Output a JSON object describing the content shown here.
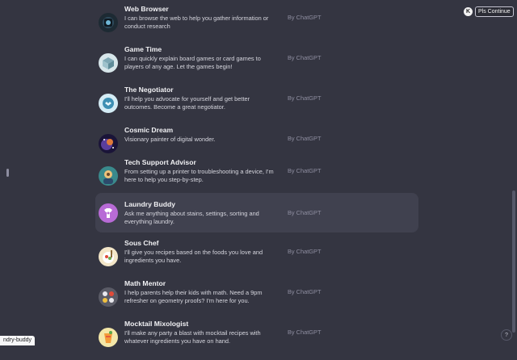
{
  "top_action": {
    "icon": "k-extension-icon",
    "icon_letter": "K",
    "label": "Pls Continue"
  },
  "gpts": [
    {
      "name": "Web Browser",
      "desc": "I can browse the web to help you gather information or conduct research",
      "by": "By ChatGPT",
      "icon": "web-browser-icon"
    },
    {
      "name": "Game Time",
      "desc": "I can quickly explain board games or card games to players of any age. Let the games begin!",
      "by": "By ChatGPT",
      "icon": "game-time-icon"
    },
    {
      "name": "The Negotiator",
      "desc": "I'll help you advocate for yourself and get better outcomes. Become a great negotiator.",
      "by": "By ChatGPT",
      "icon": "negotiator-icon"
    },
    {
      "name": "Cosmic Dream",
      "desc": "Visionary painter of digital wonder.",
      "by": "By ChatGPT",
      "icon": "cosmic-dream-icon"
    },
    {
      "name": "Tech Support Advisor",
      "desc": "From setting up a printer to troubleshooting a device, I'm here to help you step-by-step.",
      "by": "By ChatGPT",
      "icon": "tech-support-icon"
    },
    {
      "name": "Laundry Buddy",
      "desc": "Ask me anything about stains, settings, sorting and everything laundry.",
      "by": "By ChatGPT",
      "icon": "laundry-buddy-icon"
    },
    {
      "name": "Sous Chef",
      "desc": "I'll give you recipes based on the foods you love and ingredients you have.",
      "by": "By ChatGPT",
      "icon": "sous-chef-icon"
    },
    {
      "name": "Math Mentor",
      "desc": "I help parents help their kids with math. Need a 9pm refresher on geometry proofs? I'm here for you.",
      "by": "By ChatGPT",
      "icon": "math-mentor-icon"
    },
    {
      "name": "Mocktail Mixologist",
      "desc": "I'll make any party a blast with mocktail recipes with whatever ingredients you have on hand.",
      "by": "By ChatGPT",
      "icon": "mocktail-icon"
    }
  ],
  "status_bar": {
    "text": "ndry-buddy"
  },
  "help": {
    "label": "?"
  }
}
